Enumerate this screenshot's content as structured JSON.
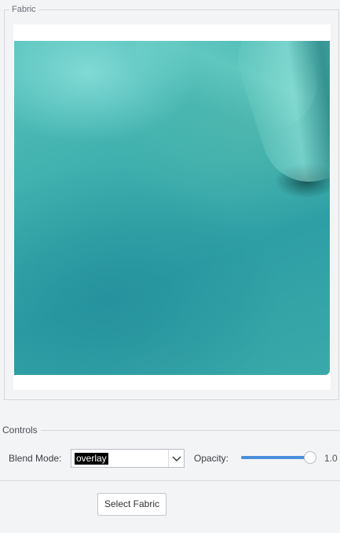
{
  "fabric_group": {
    "title": "Fabric"
  },
  "controls_group": {
    "title": "Controls"
  },
  "blend_mode": {
    "label": "Blend Mode:",
    "selected": "overlay",
    "arrow_icon": "chevron-down-icon"
  },
  "opacity": {
    "label": "Opacity:",
    "value_text": "1.0",
    "value": 1.0,
    "accent_color": "#4a8fdb"
  },
  "actions": {
    "select_fabric_label": "Select Fabric"
  }
}
